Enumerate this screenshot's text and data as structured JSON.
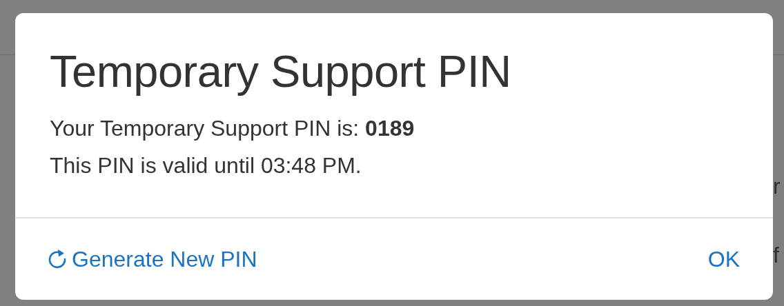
{
  "background": {
    "fragments": [
      "r",
      "f"
    ]
  },
  "dialog": {
    "title": "Temporary Support PIN",
    "lines": [
      "Your Temporary Support PIN is: **0189**",
      "This PIN is valid until 03:48 PM."
    ],
    "buttons": [
      {
        "kind": "refresh",
        "label": "Generate New PIN"
      },
      {
        "kind": "plain",
        "label": "OK"
      }
    ]
  }
}
